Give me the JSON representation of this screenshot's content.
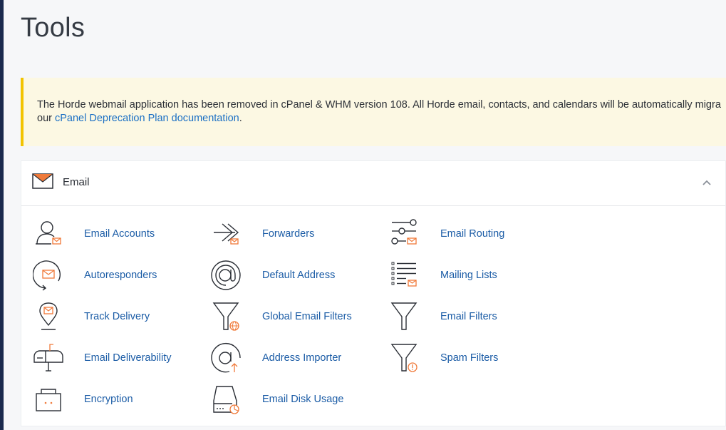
{
  "page": {
    "title": "Tools"
  },
  "notice": {
    "text_line1": "The Horde webmail application has been removed in cPanel & WHM version 108. All Horde email, contacts, and calendars will be automatically migra",
    "text_line2_prefix": "our ",
    "link_text": "cPanel Deprecation Plan documentation",
    "text_line2_suffix": "."
  },
  "email_section": {
    "title": "Email",
    "icon": "envelope-icon",
    "collapse_icon": "chevron-up-icon",
    "tools": [
      {
        "label": "Email Accounts",
        "icon": "email-accounts-icon"
      },
      {
        "label": "Forwarders",
        "icon": "forwarders-icon"
      },
      {
        "label": "Email Routing",
        "icon": "email-routing-icon"
      },
      {
        "label": "Autoresponders",
        "icon": "autoresponders-icon"
      },
      {
        "label": "Default Address",
        "icon": "default-address-icon"
      },
      {
        "label": "Mailing Lists",
        "icon": "mailing-lists-icon"
      },
      {
        "label": "Track Delivery",
        "icon": "track-delivery-icon"
      },
      {
        "label": "Global Email Filters",
        "icon": "global-email-filters-icon"
      },
      {
        "label": "Email Filters",
        "icon": "email-filters-icon"
      },
      {
        "label": "Email Deliverability",
        "icon": "email-deliverability-icon"
      },
      {
        "label": "Address Importer",
        "icon": "address-importer-icon"
      },
      {
        "label": "Spam Filters",
        "icon": "spam-filters-icon"
      },
      {
        "label": "Encryption",
        "icon": "encryption-icon"
      },
      {
        "label": "Email Disk Usage",
        "icon": "email-disk-usage-icon"
      }
    ]
  },
  "colors": {
    "link": "#1b5ca6",
    "accent_orange": "#f07a3a",
    "icon_stroke": "#2b2f36",
    "notice_bg": "#fcf8e3",
    "notice_border": "#f2c300"
  }
}
